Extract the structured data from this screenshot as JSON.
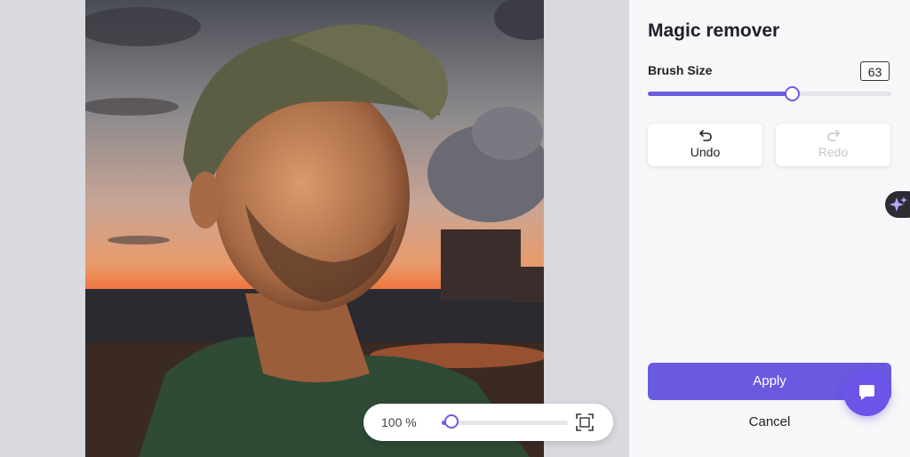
{
  "panel": {
    "title": "Magic remover",
    "brush_size_label": "Brush Size",
    "brush_size_value": "63",
    "brush_size_fraction": 0.59,
    "undo_label": "Undo",
    "redo_label": "Redo",
    "apply_label": "Apply",
    "cancel_label": "Cancel"
  },
  "zoom": {
    "label": "100 %",
    "fraction": 0.08
  },
  "icons": {
    "undo": "undo-arrow-icon",
    "redo": "redo-arrow-icon",
    "fit": "fit-screen-icon",
    "magic": "sparkle-icon",
    "chat": "chat-bubble-icon"
  },
  "colors": {
    "accent": "#6a5ae0",
    "panel_bg": "#f7f7f9",
    "canvas_bg": "#d9dadf",
    "fab_dark": "#2c2c35"
  }
}
